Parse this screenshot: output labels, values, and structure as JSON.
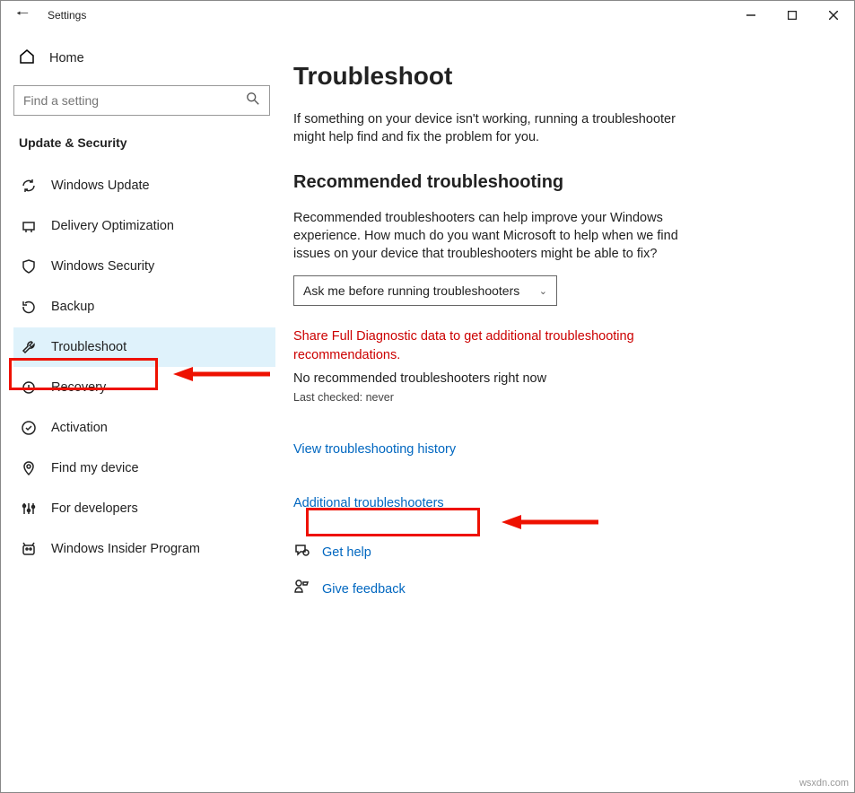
{
  "window": {
    "title": "Settings"
  },
  "sidebar": {
    "home": "Home",
    "search_placeholder": "Find a setting",
    "section": "Update & Security",
    "items": [
      {
        "label": "Windows Update"
      },
      {
        "label": "Delivery Optimization"
      },
      {
        "label": "Windows Security"
      },
      {
        "label": "Backup"
      },
      {
        "label": "Troubleshoot"
      },
      {
        "label": "Recovery"
      },
      {
        "label": "Activation"
      },
      {
        "label": "Find my device"
      },
      {
        "label": "For developers"
      },
      {
        "label": "Windows Insider Program"
      }
    ]
  },
  "main": {
    "heading": "Troubleshoot",
    "intro": "If something on your device isn't working, running a troubleshooter might help find and fix the problem for you.",
    "rec_heading": "Recommended troubleshooting",
    "rec_desc": "Recommended troubleshooters can help improve your Windows experience. How much do you want Microsoft to help when we find issues on your device that troubleshooters might be able to fix?",
    "dropdown_value": "Ask me before running troubleshooters",
    "warning": "Share Full Diagnostic data to get additional troubleshooting recommendations.",
    "no_rec": "No recommended troubleshooters right now",
    "last_checked": "Last checked: never",
    "history_link": "View troubleshooting history",
    "additional_link": "Additional troubleshooters",
    "get_help": "Get help",
    "give_feedback": "Give feedback"
  },
  "watermark": "wsxdn.com"
}
